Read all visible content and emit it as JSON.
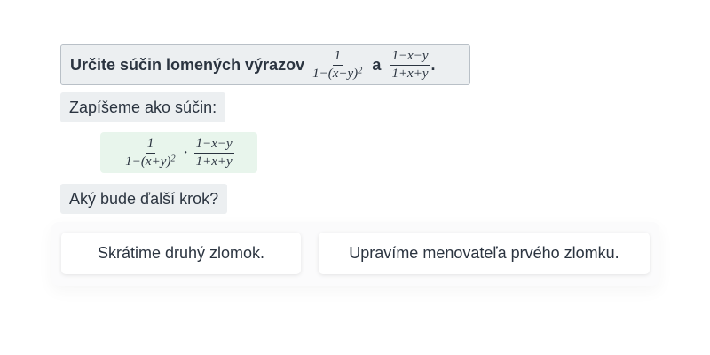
{
  "task": {
    "prefix": "Určite súčin lomených výrazov",
    "fraction_a": {
      "numerator": "1",
      "denominator_base": "1−(x+y)",
      "denominator_exponent": "2"
    },
    "connector": "a",
    "fraction_b": {
      "numerator": "1−x−y",
      "denominator": "1+x+y"
    },
    "suffix": "."
  },
  "step": {
    "label": "Zapíšeme ako súčin:",
    "product": {
      "fraction_a": {
        "numerator": "1",
        "denominator_base": "1−(x+y)",
        "denominator_exponent": "2"
      },
      "operator": "·",
      "fraction_b": {
        "numerator": "1−x−y",
        "denominator": "1+x+y"
      }
    }
  },
  "question": {
    "label": "Aký bude ďalší krok?"
  },
  "options": [
    {
      "label": "Skrátime druhý zlomok."
    },
    {
      "label": "Upravíme menovateľa prvého zlomku."
    }
  ],
  "colors": {
    "text": "#2b3440",
    "label_bg": "#eceff1",
    "task_border": "#b9c0c7",
    "product_bg": "#e8f5ec",
    "button_bg": "#ffffff"
  }
}
